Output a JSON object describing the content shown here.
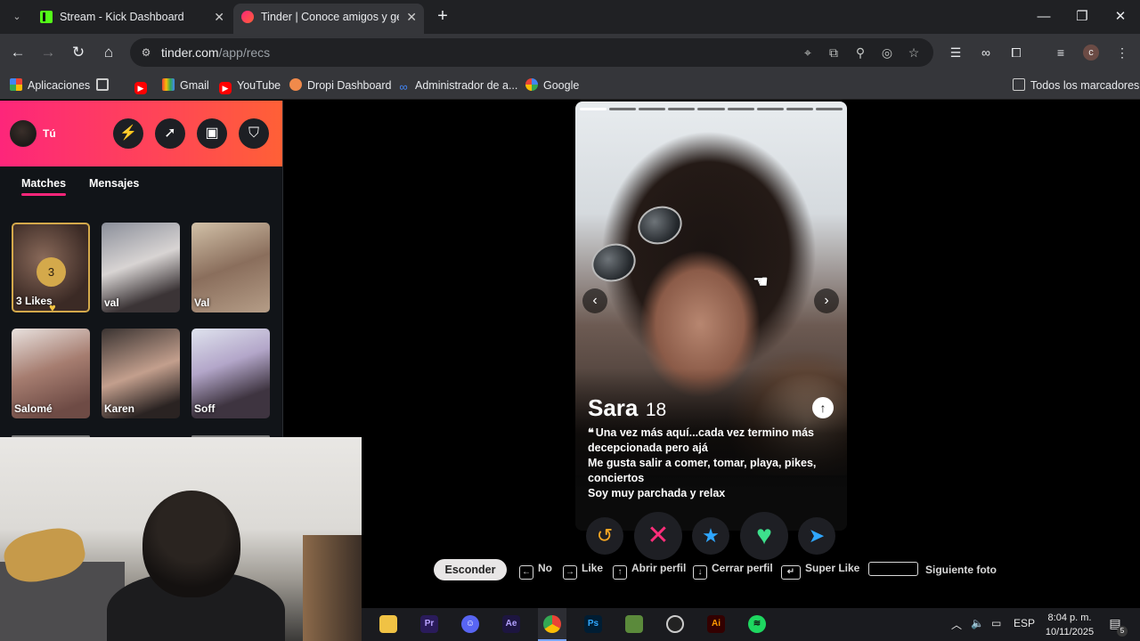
{
  "browser": {
    "tabs": [
      {
        "title": "Stream - Kick Dashboard",
        "active": false
      },
      {
        "title": "Tinder | Conoce amigos y gente",
        "active": true
      }
    ],
    "url_host": "tinder.com",
    "url_path": "/app/recs",
    "profile_initial": "c",
    "bookmarks": [
      "Aplicaciones",
      "Gmail",
      "YouTube",
      "Dropi Dashboard",
      "Administrador de a...",
      "Google"
    ],
    "bookmarks_folder": "Todos los marcadores"
  },
  "sidebar": {
    "you_label": "Tú",
    "tabs": [
      "Matches",
      "Mensajes"
    ],
    "likes_count": "3",
    "likes_label": "3 Likes",
    "matches": [
      "val",
      "Val",
      "Salomé",
      "Karen",
      "Soff"
    ]
  },
  "profile": {
    "name": "Sara",
    "age": "18",
    "bio": [
      "Una vez más aquí...cada vez termino más decepcionada pero ajá",
      "Me gusta salir a comer, tomar, playa, pikes, conciertos",
      "Soy muy parchada y relax"
    ],
    "photo_count": 9,
    "current_photo": 1
  },
  "shortcuts": {
    "hide": "Esconder",
    "no": "No",
    "like": "Like",
    "open": "Abrir perfil",
    "close": "Cerrar perfil",
    "super": "Super Like",
    "next": "Siguiente foto"
  },
  "taskbar": {
    "lang": "ESP",
    "time": "8:04 p. m.",
    "date": "10/11/2025",
    "notifications": "5"
  },
  "colors": {
    "tinder_pink": "#fd267a",
    "tinder_orange": "#ff6036",
    "like_green": "#3de08c",
    "nope_pink": "#ff2e7a"
  }
}
